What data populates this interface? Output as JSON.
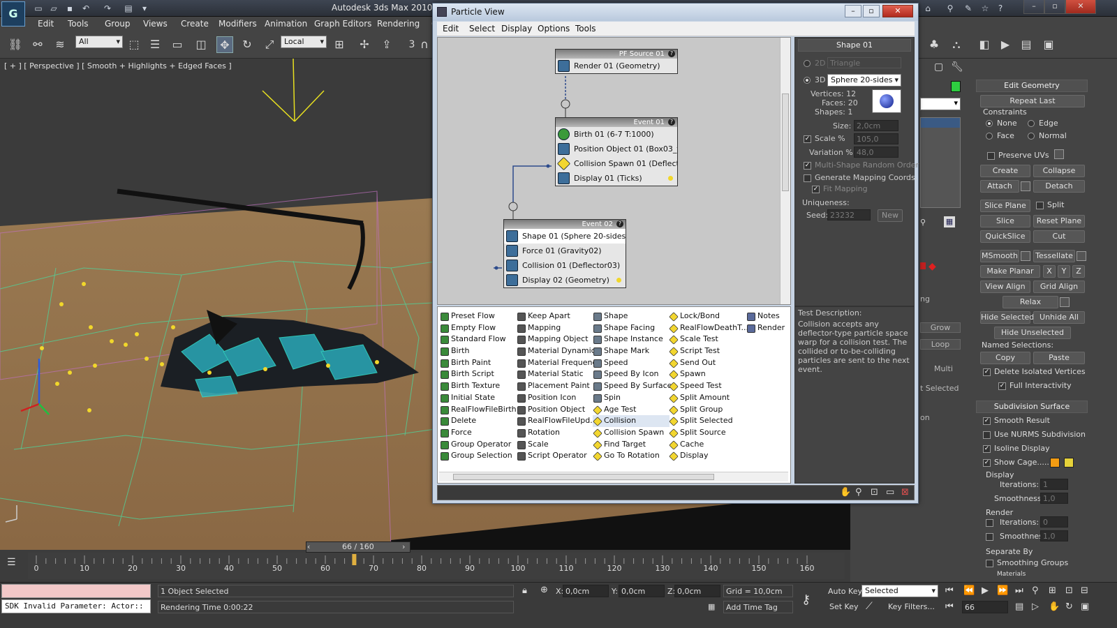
{
  "app": {
    "title": "Autodesk 3ds Max  2010 x64"
  },
  "menu": [
    "Edit",
    "Tools",
    "Group",
    "Views",
    "Create",
    "Modifiers",
    "Animation",
    "Graph Editors",
    "Rendering",
    "Cu"
  ],
  "toolbar": {
    "selection_filter": "All",
    "ref_coord": "Local",
    "snap_label": "3"
  },
  "viewport": {
    "label": "[ + ] [ Perspective ] [ Smooth + Highlights + Edged Faces ]"
  },
  "timeline": {
    "frame_display": "66 / 160",
    "ticks": [
      "0",
      "10",
      "20",
      "30",
      "40",
      "50",
      "60",
      "70",
      "80",
      "90",
      "100",
      "110",
      "120",
      "130",
      "140",
      "150",
      "160"
    ],
    "current_frame": 66,
    "total_frames": 160
  },
  "status": {
    "selected": "1 Object Selected",
    "render_time": "Rendering Time  0:00:22",
    "maxscript": "SDK Invalid Parameter: Actor::",
    "x_label": "X:",
    "x_val": "0,0cm",
    "y_label": "Y:",
    "y_val": "0,0cm",
    "z_label": "Z:",
    "z_val": "0,0cm",
    "grid": "Grid = 10,0cm",
    "add_time_tag": "Add Time Tag",
    "auto_key": "Auto Key",
    "set_key": "Set Key",
    "key_mode": "Selected",
    "key_filters": "Key Filters...",
    "frame": "66"
  },
  "particle_view": {
    "title": "Particle View",
    "menu": [
      "Edit",
      "Select",
      "Display",
      "Options",
      "Tools"
    ],
    "nodes": {
      "source": {
        "title": "PF Source 01",
        "ops": [
          "Render 01 (Geometry)"
        ]
      },
      "event1": {
        "title": "Event 01",
        "ops": [
          "Birth 01 (6-7 T:1000)",
          "Position Object 01 (Box03_f...",
          "Collision Spawn 01 (Deflect...",
          "Display 01 (Ticks)"
        ]
      },
      "event2": {
        "title": "Event 02",
        "ops": [
          "Shape 01 (Sphere 20-sides...",
          "Force 01 (Gravity02)",
          "Collision 01 (Deflector03)",
          "Display 02 (Geometry)"
        ]
      }
    },
    "depot": {
      "col1": [
        "Preset Flow",
        "Empty Flow",
        "Standard Flow",
        "Birth",
        "Birth Paint",
        "Birth Script",
        "Birth Texture",
        "Initial State",
        "RealFlowFileBirth",
        "Delete",
        "Force",
        "Group Operator",
        "Group Selection"
      ],
      "col2": [
        "Keep Apart",
        "Mapping",
        "Mapping Object",
        "Material Dynamic",
        "Material Frequency",
        "Material Static",
        "Placement Paint",
        "Position Icon",
        "Position Object",
        "RealFlowFileUpd...",
        "Rotation",
        "Scale",
        "Script Operator"
      ],
      "col3": [
        "Shape",
        "Shape Facing",
        "Shape Instance",
        "Shape Mark",
        "Speed",
        "Speed By Icon",
        "Speed By Surface",
        "Spin",
        "Age Test",
        "Collision",
        "Collision Spawn",
        "Find Target",
        "Go To Rotation"
      ],
      "col4": [
        "Lock/Bond",
        "RealFlowDeathT...",
        "Scale Test",
        "Script Test",
        "Send Out",
        "Spawn",
        "Speed Test",
        "Split Amount",
        "Split Group",
        "Split Selected",
        "Split Source",
        "Cache",
        "Display"
      ],
      "col5": [
        "Notes",
        "Render"
      ]
    },
    "params": {
      "rollout": "Shape 01",
      "mode_2d": "2D",
      "shape_2d": "Triangle",
      "mode_3d": "3D",
      "shape_3d": "Sphere 20-sides",
      "vertices": "Vertices: 12",
      "faces": "Faces: 20",
      "shapes": "Shapes: 1",
      "size_label": "Size:",
      "size": "2,0cm",
      "scale_label": "Scale %",
      "scale": "105,0",
      "variation_label": "Variation %",
      "variation": "48,0",
      "multi_shape": "Multi-Shape Random Order",
      "gen_mapping": "Generate Mapping Coords.",
      "fit_mapping": "Fit Mapping",
      "uniqueness": "Uniqueness:",
      "seed_label": "Seed:",
      "seed": "23232",
      "new_btn": "New"
    },
    "description": {
      "title": "Test Description:",
      "text": "Collision accepts any deflector-type particle space warp for a collision test. The collided or to-be-colliding particles are sent to the next event."
    }
  },
  "command_panel": {
    "edit_geometry": "Edit Geometry",
    "repeat_last": "Repeat Last",
    "constraints": "Constraints",
    "c_none": "None",
    "c_edge": "Edge",
    "c_face": "Face",
    "c_normal": "Normal",
    "preserve_uvs": "Preserve UVs",
    "create": "Create",
    "collapse": "Collapse",
    "attach": "Attach",
    "detach": "Detach",
    "slice_plane": "Slice Plane",
    "split": "Split",
    "slice": "Slice",
    "reset_plane": "Reset Plane",
    "quickslice": "QuickSlice",
    "cut": "Cut",
    "msmooth": "MSmooth",
    "tessellate": "Tessellate",
    "make_planar": "Make Planar",
    "x": "X",
    "y": "Y",
    "z": "Z",
    "view_align": "View Align",
    "grid_align": "Grid Align",
    "relax": "Relax",
    "hide_selected": "Hide Selected",
    "unhide_all": "Unhide All",
    "hide_unselected": "Hide Unselected",
    "named_selections": "Named Selections:",
    "copy": "Copy",
    "paste": "Paste",
    "delete_isolated": "Delete Isolated Vertices",
    "full_interactivity": "Full Interactivity",
    "subdivision": "Subdivision Surface",
    "smooth_result": "Smooth Result",
    "use_nurms": "Use NURMS Subdivision",
    "isoline": "Isoline Display",
    "show_cage": "Show Cage......",
    "display_group": "Display",
    "iterations_label": "Iterations:",
    "iterations": "1",
    "smoothness_label": "Smoothness:",
    "smoothness": "1,0",
    "render_group": "Render",
    "r_iterations": "0",
    "r_smoothness": "1,0",
    "separate_by": "Separate By",
    "smoothing_groups": "Smoothing Groups",
    "materials": "Materials",
    "partial_grow": "Grow",
    "partial_loop": "Loop",
    "partial_multi": "Multi",
    "partial_selected": "t Selected",
    "partial_on": "on",
    "partial_ng": "ng"
  },
  "colors": {
    "accent_green": "#2ecc40",
    "cage_orange": "#f39c12",
    "cage_yellow": "#e6d23a",
    "viewport_sky": "#3a3a3a",
    "ground": "#8a6a46"
  }
}
